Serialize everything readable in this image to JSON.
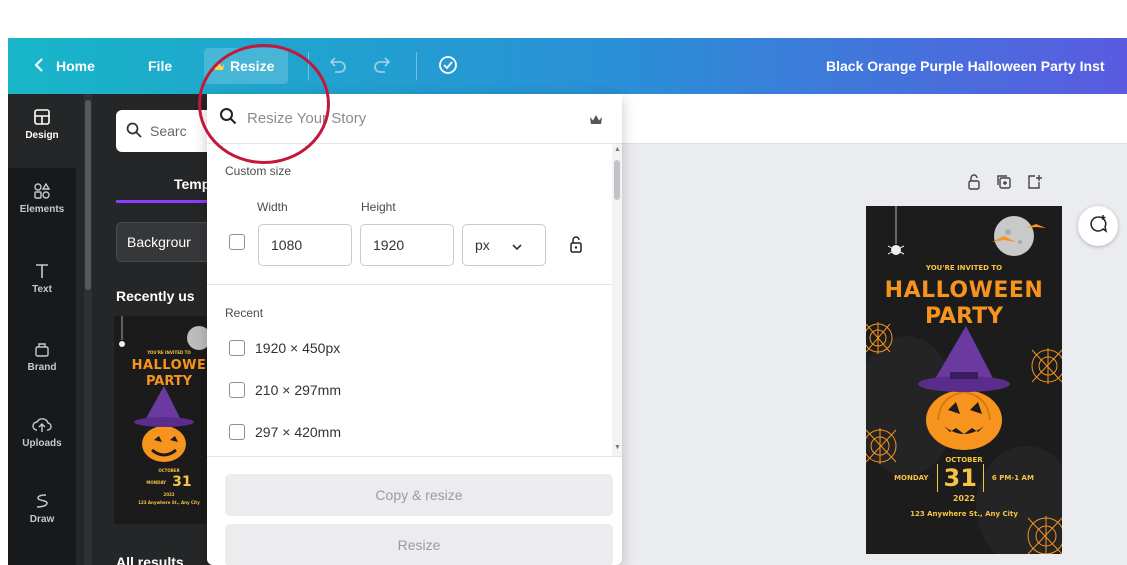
{
  "topbar": {
    "home_label": "Home",
    "file_label": "File",
    "resize_label": "Resize",
    "title": "Black Orange Purple Halloween Party Inst"
  },
  "rail": {
    "items": [
      {
        "label": "Design",
        "icon": "design-icon"
      },
      {
        "label": "Elements",
        "icon": "elements-icon"
      },
      {
        "label": "Text",
        "icon": "text-icon"
      },
      {
        "label": "Brand",
        "icon": "brand-icon"
      },
      {
        "label": "Uploads",
        "icon": "uploads-icon"
      },
      {
        "label": "Draw",
        "icon": "draw-icon"
      }
    ]
  },
  "panel": {
    "search_placeholder": "Searc",
    "tab_label": "Temp",
    "background_button": "Backgrour",
    "recent_label": "Recently us",
    "all_results_label": "All results"
  },
  "resize_menu": {
    "search_placeholder": "Resize Your Story",
    "custom_size_label": "Custom size",
    "width_label": "Width",
    "height_label": "Height",
    "width_value": "1080",
    "height_value": "1920",
    "unit": "px",
    "recent_label": "Recent",
    "recent_items": [
      "1920 × 450px",
      "210 × 297mm",
      "297 × 420mm"
    ],
    "copy_resize_label": "Copy & resize",
    "resize_label": "Resize"
  },
  "design": {
    "invited": "YOU'RE INVITED TO",
    "headline_1": "HALLOWEEN",
    "headline_2": "PARTY",
    "month": "OCTOBER",
    "weekday": "MONDAY",
    "day": "31",
    "time": "6 PM-1 AM",
    "year": "2022",
    "address": "123 Anywhere St., Any City"
  },
  "thumbnail": {
    "invited": "YOU'RE INVITED TO",
    "headline_1": "HALLOWE",
    "headline_2": "PARTY",
    "month": "OCTOBER",
    "weekday": "MONDAY",
    "day": "31",
    "year": "2022",
    "address": "123 Anywhere St., Any City"
  },
  "colors": {
    "topbar_start": "#18b6c8",
    "topbar_end": "#5a5be0",
    "accent_purple": "#8b3dff",
    "halloween_orange": "#f7941d",
    "annotation_red": "#c2183c"
  }
}
